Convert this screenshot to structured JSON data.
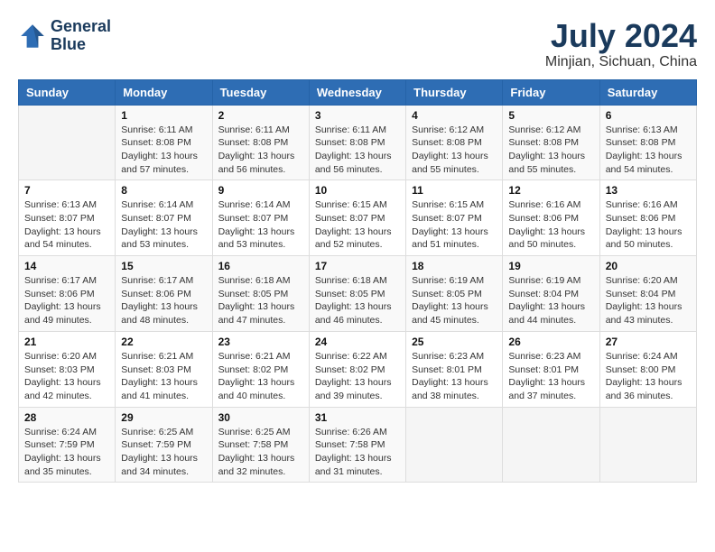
{
  "header": {
    "logo_line1": "General",
    "logo_line2": "Blue",
    "month_year": "July 2024",
    "location": "Minjian, Sichuan, China"
  },
  "weekdays": [
    "Sunday",
    "Monday",
    "Tuesday",
    "Wednesday",
    "Thursday",
    "Friday",
    "Saturday"
  ],
  "weeks": [
    [
      {
        "day": "",
        "sunrise": "",
        "sunset": "",
        "daylight": ""
      },
      {
        "day": "1",
        "sunrise": "Sunrise: 6:11 AM",
        "sunset": "Sunset: 8:08 PM",
        "daylight": "Daylight: 13 hours and 57 minutes."
      },
      {
        "day": "2",
        "sunrise": "Sunrise: 6:11 AM",
        "sunset": "Sunset: 8:08 PM",
        "daylight": "Daylight: 13 hours and 56 minutes."
      },
      {
        "day": "3",
        "sunrise": "Sunrise: 6:11 AM",
        "sunset": "Sunset: 8:08 PM",
        "daylight": "Daylight: 13 hours and 56 minutes."
      },
      {
        "day": "4",
        "sunrise": "Sunrise: 6:12 AM",
        "sunset": "Sunset: 8:08 PM",
        "daylight": "Daylight: 13 hours and 55 minutes."
      },
      {
        "day": "5",
        "sunrise": "Sunrise: 6:12 AM",
        "sunset": "Sunset: 8:08 PM",
        "daylight": "Daylight: 13 hours and 55 minutes."
      },
      {
        "day": "6",
        "sunrise": "Sunrise: 6:13 AM",
        "sunset": "Sunset: 8:08 PM",
        "daylight": "Daylight: 13 hours and 54 minutes."
      }
    ],
    [
      {
        "day": "7",
        "sunrise": "Sunrise: 6:13 AM",
        "sunset": "Sunset: 8:07 PM",
        "daylight": "Daylight: 13 hours and 54 minutes."
      },
      {
        "day": "8",
        "sunrise": "Sunrise: 6:14 AM",
        "sunset": "Sunset: 8:07 PM",
        "daylight": "Daylight: 13 hours and 53 minutes."
      },
      {
        "day": "9",
        "sunrise": "Sunrise: 6:14 AM",
        "sunset": "Sunset: 8:07 PM",
        "daylight": "Daylight: 13 hours and 53 minutes."
      },
      {
        "day": "10",
        "sunrise": "Sunrise: 6:15 AM",
        "sunset": "Sunset: 8:07 PM",
        "daylight": "Daylight: 13 hours and 52 minutes."
      },
      {
        "day": "11",
        "sunrise": "Sunrise: 6:15 AM",
        "sunset": "Sunset: 8:07 PM",
        "daylight": "Daylight: 13 hours and 51 minutes."
      },
      {
        "day": "12",
        "sunrise": "Sunrise: 6:16 AM",
        "sunset": "Sunset: 8:06 PM",
        "daylight": "Daylight: 13 hours and 50 minutes."
      },
      {
        "day": "13",
        "sunrise": "Sunrise: 6:16 AM",
        "sunset": "Sunset: 8:06 PM",
        "daylight": "Daylight: 13 hours and 50 minutes."
      }
    ],
    [
      {
        "day": "14",
        "sunrise": "Sunrise: 6:17 AM",
        "sunset": "Sunset: 8:06 PM",
        "daylight": "Daylight: 13 hours and 49 minutes."
      },
      {
        "day": "15",
        "sunrise": "Sunrise: 6:17 AM",
        "sunset": "Sunset: 8:06 PM",
        "daylight": "Daylight: 13 hours and 48 minutes."
      },
      {
        "day": "16",
        "sunrise": "Sunrise: 6:18 AM",
        "sunset": "Sunset: 8:05 PM",
        "daylight": "Daylight: 13 hours and 47 minutes."
      },
      {
        "day": "17",
        "sunrise": "Sunrise: 6:18 AM",
        "sunset": "Sunset: 8:05 PM",
        "daylight": "Daylight: 13 hours and 46 minutes."
      },
      {
        "day": "18",
        "sunrise": "Sunrise: 6:19 AM",
        "sunset": "Sunset: 8:05 PM",
        "daylight": "Daylight: 13 hours and 45 minutes."
      },
      {
        "day": "19",
        "sunrise": "Sunrise: 6:19 AM",
        "sunset": "Sunset: 8:04 PM",
        "daylight": "Daylight: 13 hours and 44 minutes."
      },
      {
        "day": "20",
        "sunrise": "Sunrise: 6:20 AM",
        "sunset": "Sunset: 8:04 PM",
        "daylight": "Daylight: 13 hours and 43 minutes."
      }
    ],
    [
      {
        "day": "21",
        "sunrise": "Sunrise: 6:20 AM",
        "sunset": "Sunset: 8:03 PM",
        "daylight": "Daylight: 13 hours and 42 minutes."
      },
      {
        "day": "22",
        "sunrise": "Sunrise: 6:21 AM",
        "sunset": "Sunset: 8:03 PM",
        "daylight": "Daylight: 13 hours and 41 minutes."
      },
      {
        "day": "23",
        "sunrise": "Sunrise: 6:21 AM",
        "sunset": "Sunset: 8:02 PM",
        "daylight": "Daylight: 13 hours and 40 minutes."
      },
      {
        "day": "24",
        "sunrise": "Sunrise: 6:22 AM",
        "sunset": "Sunset: 8:02 PM",
        "daylight": "Daylight: 13 hours and 39 minutes."
      },
      {
        "day": "25",
        "sunrise": "Sunrise: 6:23 AM",
        "sunset": "Sunset: 8:01 PM",
        "daylight": "Daylight: 13 hours and 38 minutes."
      },
      {
        "day": "26",
        "sunrise": "Sunrise: 6:23 AM",
        "sunset": "Sunset: 8:01 PM",
        "daylight": "Daylight: 13 hours and 37 minutes."
      },
      {
        "day": "27",
        "sunrise": "Sunrise: 6:24 AM",
        "sunset": "Sunset: 8:00 PM",
        "daylight": "Daylight: 13 hours and 36 minutes."
      }
    ],
    [
      {
        "day": "28",
        "sunrise": "Sunrise: 6:24 AM",
        "sunset": "Sunset: 7:59 PM",
        "daylight": "Daylight: 13 hours and 35 minutes."
      },
      {
        "day": "29",
        "sunrise": "Sunrise: 6:25 AM",
        "sunset": "Sunset: 7:59 PM",
        "daylight": "Daylight: 13 hours and 34 minutes."
      },
      {
        "day": "30",
        "sunrise": "Sunrise: 6:25 AM",
        "sunset": "Sunset: 7:58 PM",
        "daylight": "Daylight: 13 hours and 32 minutes."
      },
      {
        "day": "31",
        "sunrise": "Sunrise: 6:26 AM",
        "sunset": "Sunset: 7:58 PM",
        "daylight": "Daylight: 13 hours and 31 minutes."
      },
      {
        "day": "",
        "sunrise": "",
        "sunset": "",
        "daylight": ""
      },
      {
        "day": "",
        "sunrise": "",
        "sunset": "",
        "daylight": ""
      },
      {
        "day": "",
        "sunrise": "",
        "sunset": "",
        "daylight": ""
      }
    ]
  ]
}
